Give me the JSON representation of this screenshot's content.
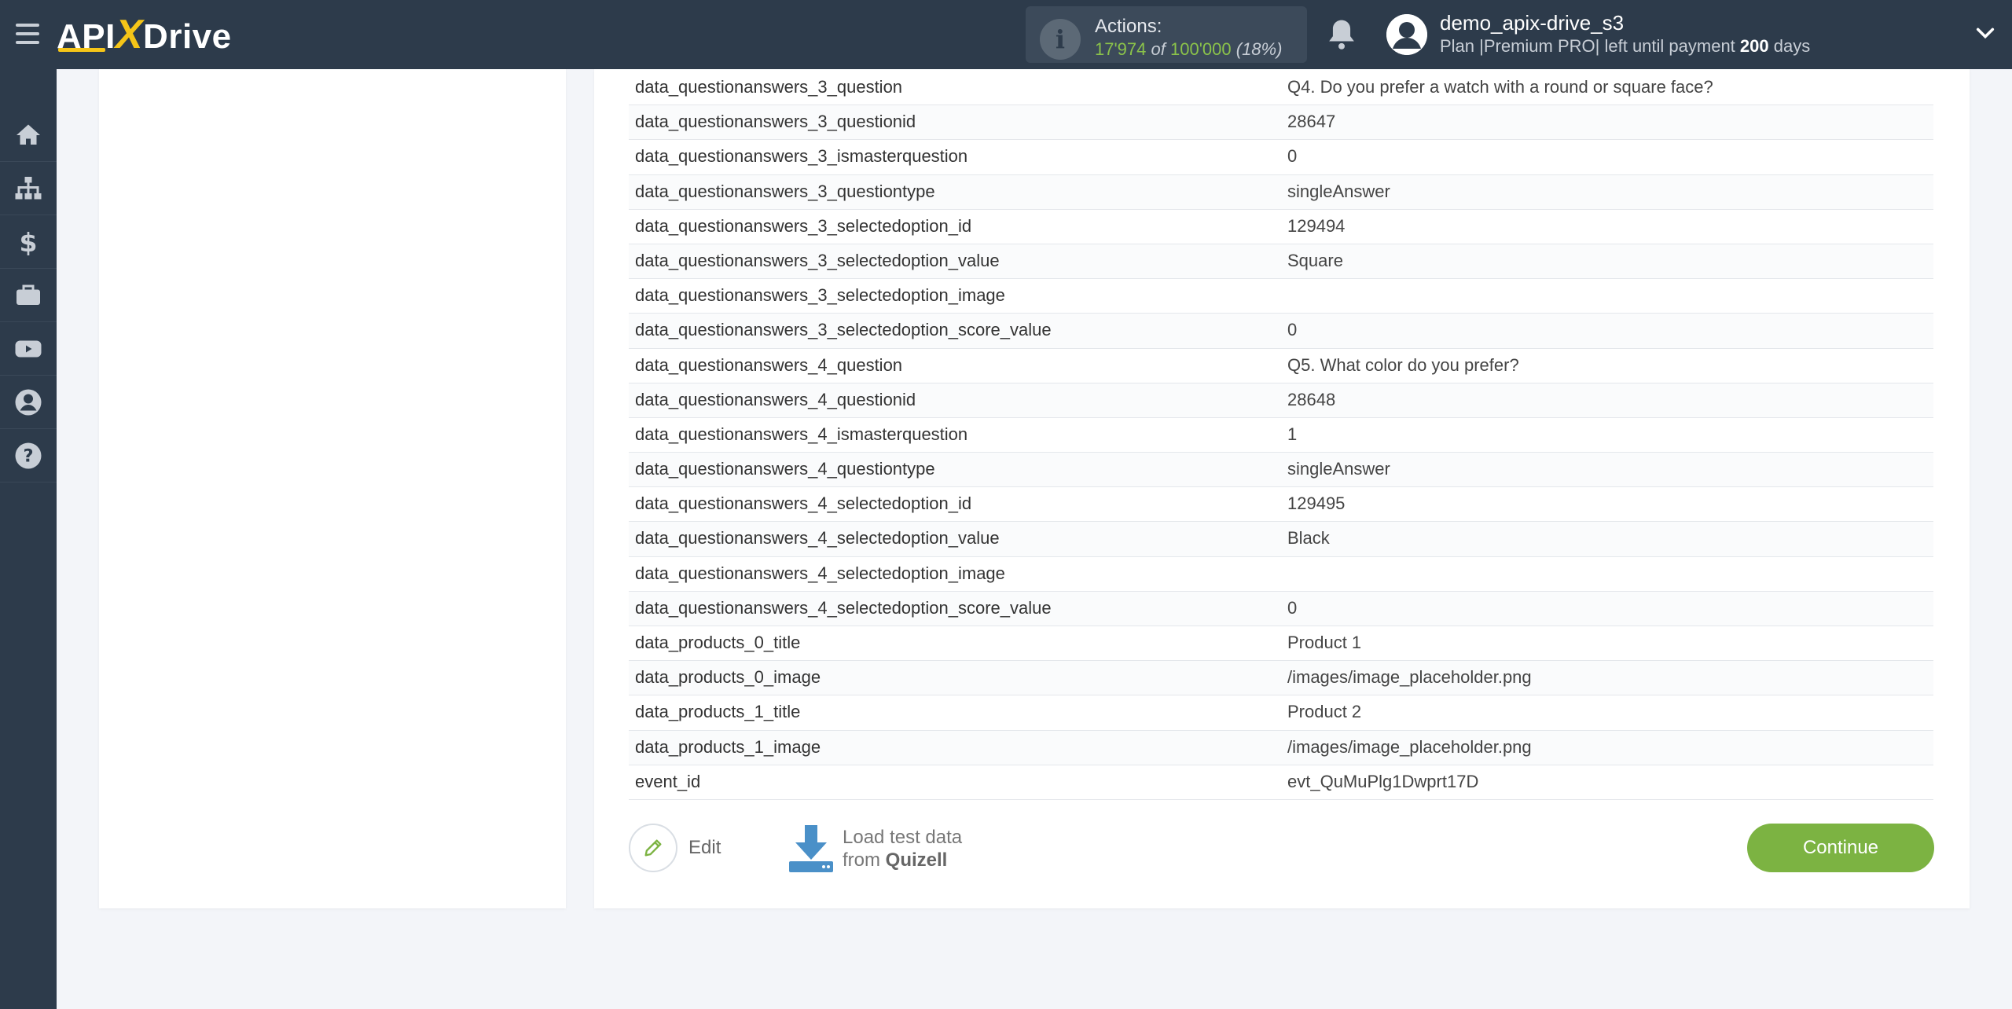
{
  "header": {
    "logo_pre": "API",
    "logo_x": "X",
    "logo_post": "Drive",
    "actions_label": "Actions:",
    "actions_used": "17'974",
    "actions_of": "of",
    "actions_total": "100'000",
    "actions_percent": "(18%)",
    "user_name": "demo_apix-drive_s3",
    "plan_prefix": "Plan |Premium PRO| left until payment",
    "plan_days": "200",
    "plan_suffix": "days"
  },
  "sidebar": {
    "items": [
      {
        "icon": "home-icon"
      },
      {
        "icon": "sitemap-icon"
      },
      {
        "icon": "dollar-icon"
      },
      {
        "icon": "briefcase-icon"
      },
      {
        "icon": "youtube-icon"
      },
      {
        "icon": "user-icon"
      },
      {
        "icon": "help-icon"
      }
    ]
  },
  "table": {
    "rows": [
      {
        "key": "data_questionanswers_3_question",
        "value": "Q4. Do you prefer a watch with a round or square face?"
      },
      {
        "key": "data_questionanswers_3_questionid",
        "value": "28647"
      },
      {
        "key": "data_questionanswers_3_ismasterquestion",
        "value": "0"
      },
      {
        "key": "data_questionanswers_3_questiontype",
        "value": "singleAnswer"
      },
      {
        "key": "data_questionanswers_3_selectedoption_id",
        "value": "129494"
      },
      {
        "key": "data_questionanswers_3_selectedoption_value",
        "value": "Square"
      },
      {
        "key": "data_questionanswers_3_selectedoption_image",
        "value": ""
      },
      {
        "key": "data_questionanswers_3_selectedoption_score_value",
        "value": "0"
      },
      {
        "key": "data_questionanswers_4_question",
        "value": "Q5. What color do you prefer?"
      },
      {
        "key": "data_questionanswers_4_questionid",
        "value": "28648"
      },
      {
        "key": "data_questionanswers_4_ismasterquestion",
        "value": "1"
      },
      {
        "key": "data_questionanswers_4_questiontype",
        "value": "singleAnswer"
      },
      {
        "key": "data_questionanswers_4_selectedoption_id",
        "value": "129495"
      },
      {
        "key": "data_questionanswers_4_selectedoption_value",
        "value": "Black"
      },
      {
        "key": "data_questionanswers_4_selectedoption_image",
        "value": ""
      },
      {
        "key": "data_questionanswers_4_selectedoption_score_value",
        "value": "0"
      },
      {
        "key": "data_products_0_title",
        "value": "Product 1"
      },
      {
        "key": "data_products_0_image",
        "value": "/images/image_placeholder.png"
      },
      {
        "key": "data_products_1_title",
        "value": "Product 2"
      },
      {
        "key": "data_products_1_image",
        "value": "/images/image_placeholder.png"
      },
      {
        "key": "event_id",
        "value": "evt_QuMuPlg1Dwprt17D"
      }
    ]
  },
  "footer": {
    "edit_label": "Edit",
    "load_line1": "Load test data",
    "load_from": "from",
    "load_source": "Quizell",
    "continue_label": "Continue"
  },
  "colors": {
    "topbar": "#2d3b4b",
    "accent_green": "#7cb342",
    "logo_yellow": "#f5c518",
    "icon_blue": "#4a90c8"
  }
}
